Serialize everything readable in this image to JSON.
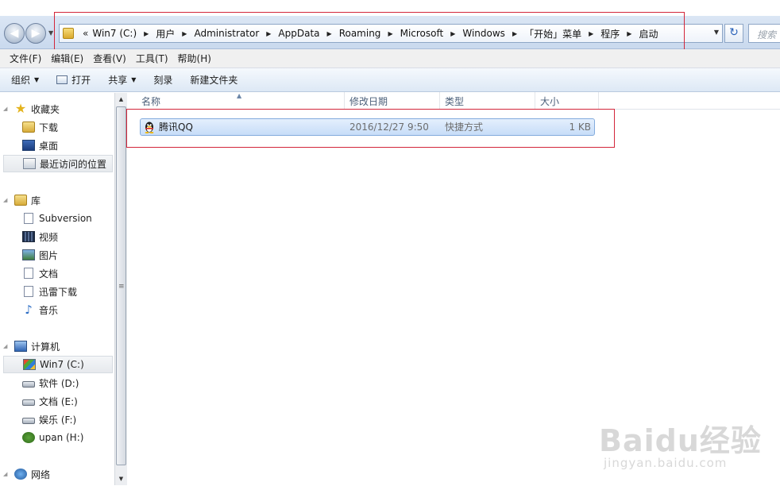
{
  "address": {
    "overflow": "«",
    "crumbs": [
      "Win7 (C:)",
      "用户",
      "Administrator",
      "AppData",
      "Roaming",
      "Microsoft",
      "Windows",
      "「开始」菜单",
      "程序",
      "启动"
    ],
    "search_placeholder": "搜索"
  },
  "menu": [
    "文件(F)",
    "编辑(E)",
    "查看(V)",
    "工具(T)",
    "帮助(H)"
  ],
  "toolbar": {
    "organize": "组织",
    "open": "打开",
    "share": "共享",
    "burn": "刻录",
    "new_folder": "新建文件夹"
  },
  "nav": {
    "favorites": {
      "label": "收藏夹",
      "items": [
        "下载",
        "桌面",
        "最近访问的位置"
      ]
    },
    "libraries": {
      "label": "库",
      "items": [
        "Subversion",
        "视频",
        "图片",
        "文档",
        "迅雷下载",
        "音乐"
      ]
    },
    "computer": {
      "label": "计算机",
      "items": [
        "Win7 (C:)",
        "软件 (D:)",
        "文档 (E:)",
        "娱乐 (F:)",
        "upan (H:)"
      ]
    },
    "network": {
      "label": "网络"
    }
  },
  "columns": {
    "name": "名称",
    "modified": "修改日期",
    "type": "类型",
    "size": "大小"
  },
  "files": [
    {
      "name": "腾讯QQ",
      "modified": "2016/12/27 9:50",
      "type": "快捷方式",
      "size": "1 KB"
    }
  ],
  "watermark": {
    "brand": "Baidu经验",
    "site": "jingyan.baidu.com"
  }
}
